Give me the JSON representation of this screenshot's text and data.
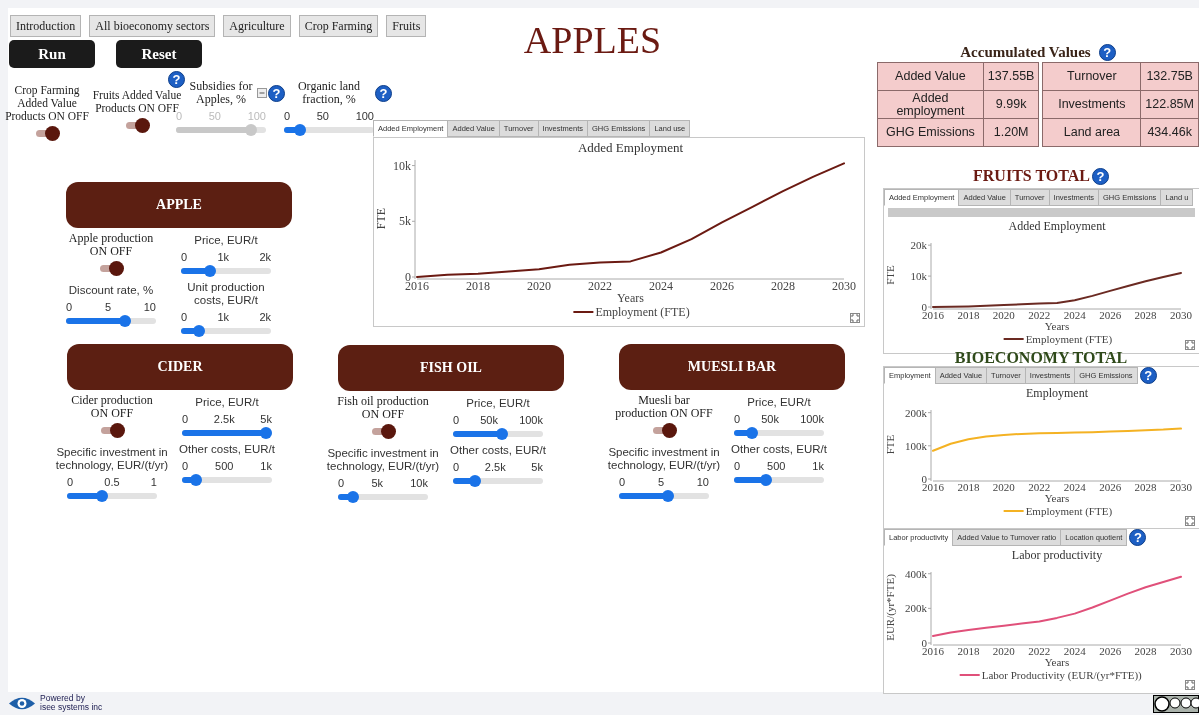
{
  "nav": [
    {
      "label": "Introduction"
    },
    {
      "label": "All bioeconomy sectors"
    },
    {
      "label": "Agriculture"
    },
    {
      "label": "Crop Farming"
    },
    {
      "label": "Fruits"
    }
  ],
  "actions": [
    "Run",
    "Reset"
  ],
  "title": "APPLES",
  "settings": [
    {
      "kind": "toggle",
      "label": "Crop Farming Added Value Products ON OFF",
      "on": true
    },
    {
      "kind": "toggle",
      "label": "Fruits Added Value Products ON OFF",
      "on": true,
      "help": "?"
    },
    {
      "kind": "slider",
      "label": "Subsidies for Apples, %",
      "ticks": [
        "0",
        "50",
        "100"
      ],
      "level": 0.88,
      "disabled": true,
      "help": "?"
    },
    {
      "kind": "slider",
      "label": "Organic land fraction, %",
      "ticks": [
        "0",
        "50",
        "100"
      ],
      "level": 0.13,
      "disabled": false,
      "help": "?"
    }
  ],
  "main_chart": {
    "tabs": [
      {
        "label": "Added Employment",
        "selected": true
      },
      {
        "label": "Added Value",
        "selected": false
      },
      {
        "label": "Turnover",
        "selected": false
      },
      {
        "label": "Investments",
        "selected": false
      },
      {
        "label": "GHG Emissions",
        "selected": false
      },
      {
        "label": "Land use",
        "selected": false
      }
    ],
    "chart_data": {
      "type": "line",
      "title": "Added Employment",
      "xlabel": "Years",
      "ylabel": "FTE",
      "x": [
        2016,
        2017,
        2018,
        2019,
        2020,
        2021,
        2022,
        2023,
        2024,
        2025,
        2026,
        2027,
        2028,
        2029,
        2030
      ],
      "xlim": [
        2016,
        2030
      ],
      "ylim": [
        0,
        10500
      ],
      "xticks": [
        2016,
        2018,
        2020,
        2022,
        2024,
        2026,
        2028,
        2030
      ],
      "yticks": [
        {
          "value": 0,
          "label": "0"
        },
        {
          "value": 5000,
          "label": "5k"
        },
        {
          "value": 10000,
          "label": "10k"
        }
      ],
      "series": [
        {
          "name": "Employment (FTE)",
          "color": "#6b1a12",
          "values": [
            0,
            200,
            300,
            500,
            700,
            1100,
            1300,
            1400,
            2200,
            3400,
            4900,
            6300,
            7700,
            9000,
            10200
          ]
        }
      ]
    }
  },
  "products": [
    {
      "name": "APPLE",
      "production": {
        "label": "Apple production ON OFF",
        "on": true
      },
      "left": [
        {
          "label": "Discount rate, %",
          "ticks": [
            "0",
            "5",
            "10"
          ],
          "level": 0.68,
          "disabled": false
        }
      ],
      "right": [
        {
          "label": "Price, EUR/t",
          "ticks": [
            "0",
            "1k",
            "2k"
          ],
          "level": 0.3,
          "disabled": false
        },
        {
          "label": "Unit production costs, EUR/t",
          "ticks": [
            "0",
            "1k",
            "2k"
          ],
          "level": 0.15,
          "disabled": false
        }
      ]
    },
    {
      "name": "CIDER",
      "production": {
        "label": "Cider production ON OFF",
        "on": true
      },
      "left": [
        {
          "label": "Specific investment in technology, EUR/(t/yr)",
          "ticks": [
            "0",
            "0.5",
            "1"
          ],
          "level": 0.37,
          "disabled": false
        }
      ],
      "right": [
        {
          "label": "Price, EUR/t",
          "ticks": [
            "0",
            "2.5k",
            "5k"
          ],
          "level": 1,
          "disabled": false
        },
        {
          "label": "Other costs, EUR/t",
          "ticks": [
            "0",
            "500",
            "1k"
          ],
          "level": 0.1,
          "disabled": false
        }
      ]
    },
    {
      "name": "FISH OIL",
      "production": {
        "label": "Fish oil production ON OFF",
        "on": true
      },
      "left": [
        {
          "label": "Specific investment in technology, EUR/(t/yr)",
          "ticks": [
            "0",
            "5k",
            "10k"
          ],
          "level": 0.12,
          "disabled": false
        }
      ],
      "right": [
        {
          "label": "Price, EUR/t",
          "ticks": [
            "0",
            "50k",
            "100k"
          ],
          "level": 0.55,
          "disabled": false
        },
        {
          "label": "Other costs, EUR/t",
          "ticks": [
            "0",
            "2.5k",
            "5k"
          ],
          "level": 0.2,
          "disabled": false
        }
      ]
    },
    {
      "name": "MUESLI BAR",
      "production": {
        "label": "Muesli bar production ON OFF",
        "on": true
      },
      "left": [
        {
          "label": "Specific investment in technology, EUR/(t/yr)",
          "ticks": [
            "0",
            "5",
            "10"
          ],
          "level": 0.55,
          "disabled": false
        }
      ],
      "right": [
        {
          "label": "Price, EUR/t",
          "ticks": [
            "0",
            "50k",
            "100k"
          ],
          "level": 0.15,
          "disabled": false
        },
        {
          "label": "Other costs, EUR/t",
          "ticks": [
            "0",
            "500",
            "1k"
          ],
          "level": 0.33,
          "disabled": false
        }
      ]
    }
  ],
  "accumulated": {
    "title": "Accumulated Values",
    "help": "?",
    "tables": [
      [
        {
          "label": "Added Value",
          "value": "137.55B"
        },
        {
          "label": "Added employment",
          "value": "9.99k"
        },
        {
          "label": "GHG Emissions",
          "value": "1.20M"
        }
      ],
      [
        {
          "label": "Turnover",
          "value": "132.75B"
        },
        {
          "label": "Investments",
          "value": "122.85M"
        },
        {
          "label": "Land area",
          "value": "434.46k"
        }
      ]
    ]
  },
  "fruits_total": {
    "title": "FRUITS TOTAL",
    "help": "?",
    "tabs": [
      {
        "label": "Added Employment",
        "selected": true
      },
      {
        "label": "Added Value",
        "selected": false
      },
      {
        "label": "Turnover",
        "selected": false
      },
      {
        "label": "Investments",
        "selected": false
      },
      {
        "label": "GHG Emissions",
        "selected": false
      },
      {
        "label": "Land u",
        "selected": false
      }
    ],
    "chart_data": {
      "type": "line",
      "title": "Added Employment",
      "xlabel": "Years",
      "ylabel": "FTE",
      "x": [
        2016,
        2017,
        2018,
        2019,
        2020,
        2021,
        2022,
        2023,
        2024,
        2025,
        2026,
        2027,
        2028,
        2029,
        2030
      ],
      "xlim": [
        2016,
        2030
      ],
      "ylim": [
        0,
        20700
      ],
      "xticks": [
        2016,
        2018,
        2020,
        2022,
        2024,
        2026,
        2028,
        2030
      ],
      "yticks": [
        {
          "value": 0,
          "label": "0"
        },
        {
          "value": 10000,
          "label": "10k"
        },
        {
          "value": 20000,
          "label": "20k"
        }
      ],
      "series": [
        {
          "name": "Employment (FTE)",
          "color": "#6b2a22",
          "values": [
            0,
            100,
            200,
            400,
            600,
            900,
            1100,
            1300,
            2200,
            3600,
            5200,
            6800,
            8300,
            9700,
            11000
          ]
        }
      ]
    }
  },
  "bioeconomy_total": {
    "title": "BIOECONOMY TOTAL",
    "help": "?",
    "tabs": [
      {
        "label": "Employment",
        "selected": true
      },
      {
        "label": "Added Value",
        "selected": false
      },
      {
        "label": "Turnover",
        "selected": false
      },
      {
        "label": "Investments",
        "selected": false
      },
      {
        "label": "GHG Emissions",
        "selected": false
      }
    ],
    "chart_data": {
      "type": "line",
      "title": "Employment",
      "xlabel": "Years",
      "ylabel": "FTE",
      "x": [
        2016,
        2017,
        2018,
        2019,
        2020,
        2021,
        2022,
        2023,
        2024,
        2025,
        2026,
        2027,
        2028,
        2029,
        2030
      ],
      "xlim": [
        2016,
        2030
      ],
      "ylim": [
        0,
        208000
      ],
      "xticks": [
        2016,
        2018,
        2020,
        2022,
        2024,
        2026,
        2028,
        2030
      ],
      "yticks": [
        {
          "value": 0,
          "label": "0"
        },
        {
          "value": 100000,
          "label": "100k"
        },
        {
          "value": 200000,
          "label": "200k"
        }
      ],
      "series": [
        {
          "name": "Employment (FTE)",
          "color": "#f4b223",
          "values": [
            85000,
            106000,
            120000,
            128000,
            133000,
            136000,
            138000,
            139000,
            140000,
            141000,
            143000,
            145000,
            147000,
            149000,
            152000
          ]
        }
      ]
    }
  },
  "indicators": {
    "help": "?",
    "tabs": [
      {
        "label": "Labor productivity",
        "selected": true
      },
      {
        "label": "Added Value to Turnover ratio",
        "selected": false
      },
      {
        "label": "Location quotient",
        "selected": false
      }
    ],
    "chart_data": {
      "type": "line",
      "title": "Labor productivity",
      "xlabel": "Years",
      "ylabel": "EUR/(yr*FTE)",
      "x": [
        2016,
        2017,
        2018,
        2019,
        2020,
        2021,
        2022,
        2023,
        2024,
        2025,
        2026,
        2027,
        2028,
        2029,
        2030
      ],
      "xlim": [
        2016,
        2030
      ],
      "ylim": [
        0,
        410000
      ],
      "xticks": [
        2016,
        2018,
        2020,
        2022,
        2024,
        2026,
        2028,
        2030
      ],
      "yticks": [
        {
          "value": 0,
          "label": "0"
        },
        {
          "value": 200000,
          "label": "200k"
        },
        {
          "value": 400000,
          "label": "400k"
        }
      ],
      "series": [
        {
          "name": "Labor Productivity (EUR/(yr*FTE))",
          "color": "#e0507a",
          "values": [
            40000,
            60000,
            75000,
            88000,
            100000,
            112000,
            125000,
            145000,
            170000,
            205000,
            245000,
            285000,
            322000,
            352000,
            382000
          ]
        }
      ]
    }
  },
  "footer": {
    "powered_by": "Powered by",
    "company": "isee systems inc"
  }
}
